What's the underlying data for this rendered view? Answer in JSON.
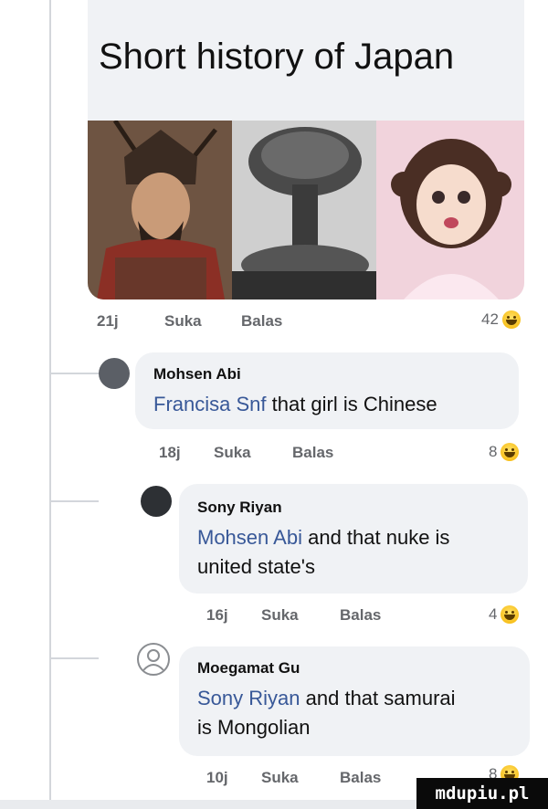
{
  "post": {
    "title": "Short history of Japan",
    "panels": [
      {
        "name": "samurai",
        "bg": "#7a5b45"
      },
      {
        "name": "nuke",
        "bg": "#d9d9d9"
      },
      {
        "name": "anime-girl",
        "bg": "#f3c9d6"
      }
    ],
    "meta": {
      "time": "21j",
      "like": "Suka",
      "reply": "Balas",
      "count": "42"
    }
  },
  "comments": [
    {
      "author": "Mohsen Abi",
      "mention": "Francisa Snf",
      "lines": [
        "that girl is Chinese"
      ],
      "meta": {
        "time": "18j",
        "like": "Suka",
        "reply": "Balas",
        "count": "8"
      }
    },
    {
      "author": "Sony Riyan",
      "mention": "Mohsen Abi",
      "lines": [
        "and that nuke is",
        "united state's"
      ],
      "meta": {
        "time": "16j",
        "like": "Suka",
        "reply": "Balas",
        "count": "4"
      }
    },
    {
      "author": "Moegamat Gu",
      "mention": "Sony Riyan",
      "lines": [
        "and that samurai",
        "is Mongolian"
      ],
      "meta": {
        "time": "10j",
        "like": "Suka",
        "reply": "Balas",
        "count": "8"
      }
    }
  ],
  "watermark": "mdupiu.pl",
  "colors": {
    "bubble": "#f0f2f5",
    "mention": "#385898",
    "meta": "#65676b"
  }
}
